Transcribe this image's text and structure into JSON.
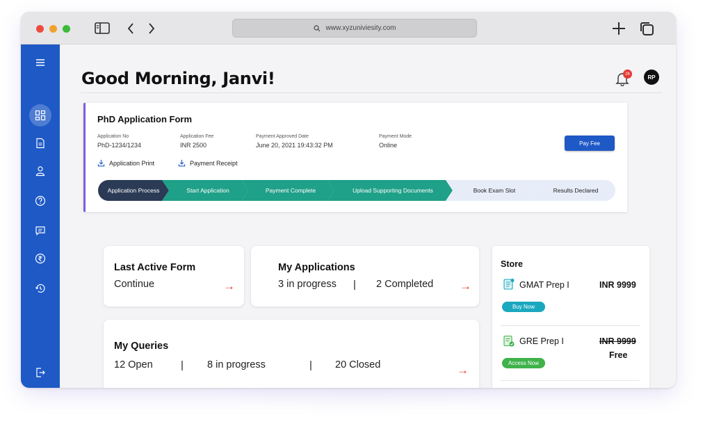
{
  "browser": {
    "url": "www.xyzuniviesity.com"
  },
  "header": {
    "greeting": "Good Morning, Janvi!",
    "notification_count": "26",
    "avatar_initials": "RP"
  },
  "sidebar": {
    "items": [
      {
        "icon": "menu-icon"
      },
      {
        "icon": "dashboard-icon",
        "active": true
      },
      {
        "icon": "document-icon"
      },
      {
        "icon": "user-icon"
      },
      {
        "icon": "help-icon"
      },
      {
        "icon": "chat-icon"
      },
      {
        "icon": "rupee-icon"
      },
      {
        "icon": "history-icon"
      },
      {
        "icon": "logout-icon"
      }
    ]
  },
  "application": {
    "title": "PhD Application Form",
    "fields": [
      {
        "label": "Application No",
        "value": "PhD-1234/1234"
      },
      {
        "label": "Application Fee",
        "value": "INR 2500"
      },
      {
        "label": "Payment Approved Date",
        "value": "June 20, 2021 19:43:32 PM"
      },
      {
        "label": "Payment Mode",
        "value": "Online"
      }
    ],
    "downloads": [
      "Application Print",
      "Payment Receipt"
    ],
    "pay_button": "Pay Fee",
    "steps": [
      {
        "label": "Application Process",
        "status": "current"
      },
      {
        "label": "Start Application",
        "status": "done"
      },
      {
        "label": "Payment Complete",
        "status": "done"
      },
      {
        "label": "Upload Supporting Documents",
        "status": "done"
      },
      {
        "label": "Book Exam Slot",
        "status": "pending"
      },
      {
        "label": "Results Declared",
        "status": "pending"
      }
    ]
  },
  "last_active": {
    "title": "Last Active Form",
    "action": "Continue",
    "arrow": "→"
  },
  "my_applications": {
    "title": "My Applications",
    "in_progress": "3 in progress",
    "separator": "|",
    "completed": "2 Completed",
    "arrow": "→"
  },
  "my_queries": {
    "title": "My Queries",
    "open": "12 Open",
    "separator": "|",
    "in_progress": "8 in progress",
    "closed": "20 Closed",
    "arrow": "→"
  },
  "store": {
    "title": "Store",
    "products": [
      {
        "name": "GMAT Prep I",
        "price": "INR 9999",
        "button": "Buy Now"
      },
      {
        "name": "GRE Prep I",
        "price": "INR 9999",
        "price_note": "Free",
        "button": "Access Now"
      }
    ]
  },
  "colors": {
    "sidebar": "#1e59c6",
    "step_current": "#2b3a55",
    "step_done": "#1fa088",
    "step_pending": "#e7edf8",
    "accent_purple": "#7c5ce0",
    "arrow_red": "#e53935",
    "buy_now": "#1aa8bf",
    "access_now": "#3fb24a"
  }
}
